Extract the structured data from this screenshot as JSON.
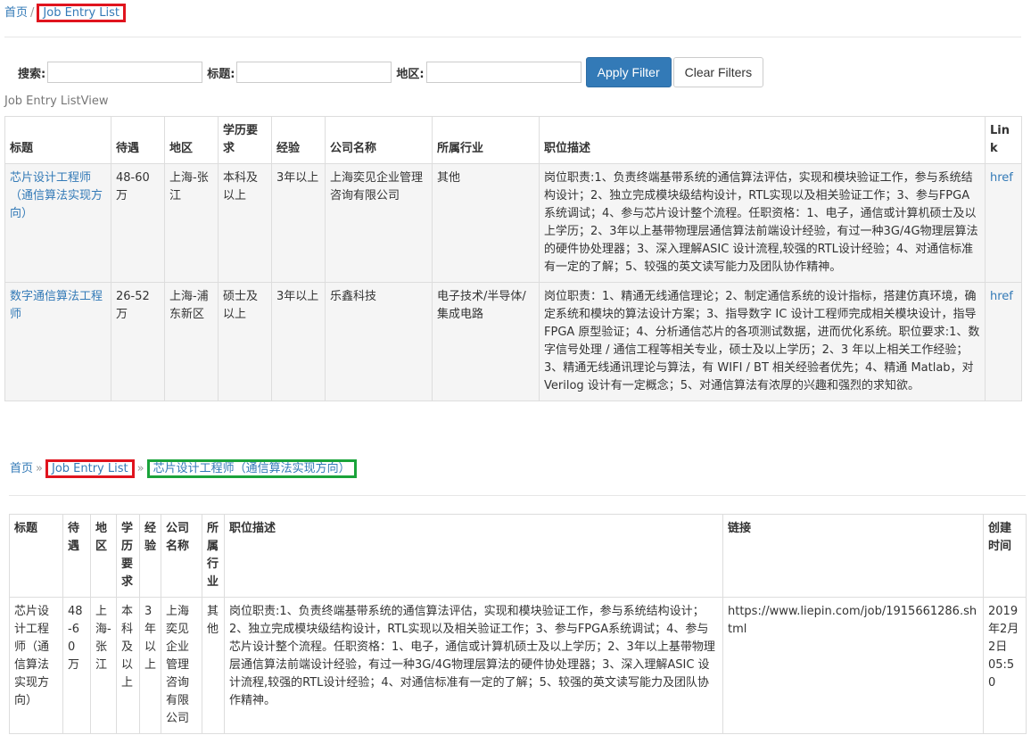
{
  "breadcrumb1": {
    "home": "首页",
    "sep": "/",
    "current": "Job Entry List"
  },
  "filters": {
    "search_label": "搜索:",
    "title_label": "标题:",
    "region_label": "地区:",
    "apply": "Apply Filter",
    "clear": "Clear Filters"
  },
  "listview_caption": "Job Entry ListView",
  "table1": {
    "headers": [
      "标题",
      "待遇",
      "地区",
      "学历要求",
      "经验",
      "公司名称",
      "所属行业",
      "职位描述",
      "Link"
    ],
    "rows": [
      {
        "title": "芯片设计工程师（通信算法实现方向）",
        "salary": "48-60万",
        "region": "上海-张江",
        "education": "本科及以上",
        "experience": "3年以上",
        "company": "上海奕见企业管理咨询有限公司",
        "industry": "其他",
        "description": "岗位职责:1、负责终端基带系统的通信算法评估，实现和模块验证工作，参与系统结构设计；2、独立完成模块级结构设计，RTL实现以及相关验证工作；3、参与FPGA系统调试；4、参与芯片设计整个流程。任职资格：1、电子，通信或计算机硕士及以上学历；2、3年以上基带物理层通信算法前端设计经验，有过一种3G/4G物理层算法的硬件协处理器；3、深入理解ASIC 设计流程,较强的RTL设计经验；4、对通信标准有一定的了解；5、较强的英文读写能力及团队协作精神。",
        "link": "href"
      },
      {
        "title": "数字通信算法工程师",
        "salary": "26-52万",
        "region": "上海-浦东新区",
        "education": "硕士及以上",
        "experience": "3年以上",
        "company": "乐鑫科技",
        "industry": "电子技术/半导体/集成电路",
        "description": "岗位职责：1、精通无线通信理论；2、制定通信系统的设计指标，搭建仿真环境，确定系统和模块的算法设计方案；3、指导数字 IC 设计工程师完成相关模块设计，指导 FPGA 原型验证；4、分析通信芯片的各项测试数据，进而优化系统。职位要求:1、数字信号处理 / 通信工程等相关专业，硕士及以上学历；2、3 年以上相关工作经验；3、精通无线通讯理论与算法，有 WIFI / BT 相关经验者优先；4、精通 Matlab，对 Verilog 设计有一定概念；5、对通信算法有浓厚的兴趣和强烈的求知欲。",
        "link": "href"
      }
    ]
  },
  "breadcrumb2": {
    "home": "首页",
    "sep": "»",
    "list": "Job Entry List",
    "current": "芯片设计工程师（通信算法实现方向）"
  },
  "table2": {
    "headers": [
      "标题",
      "待遇",
      "地区",
      "学历要求",
      "经验",
      "公司名称",
      "所属行业",
      "职位描述",
      "链接",
      "创建时间"
    ],
    "row": {
      "title": "芯片设计工程师（通信算法实现方向）",
      "salary": "48-60万",
      "region": "上海-张江",
      "education": "本科及以上",
      "experience": "3年以上",
      "company": "上海奕见企业管理咨询有限公司",
      "industry": "其他",
      "description": "岗位职责:1、负责终端基带系统的通信算法评估，实现和模块验证工作，参与系统结构设计；2、独立完成模块级结构设计，RTL实现以及相关验证工作；3、参与FPGA系统调试；4、参与芯片设计整个流程。任职资格：1、电子，通信或计算机硕士及以上学历；2、3年以上基带物理层通信算法前端设计经验，有过一种3G/4G物理层算法的硬件协处理器；3、深入理解ASIC 设计流程,较强的RTL设计经验；4、对通信标准有一定的了解；5、较强的英文读写能力及团队协作精神。",
      "url": "https://www.liepin.com/job/1915661286.shtml",
      "created": "2019年2月2日 05:50"
    }
  }
}
